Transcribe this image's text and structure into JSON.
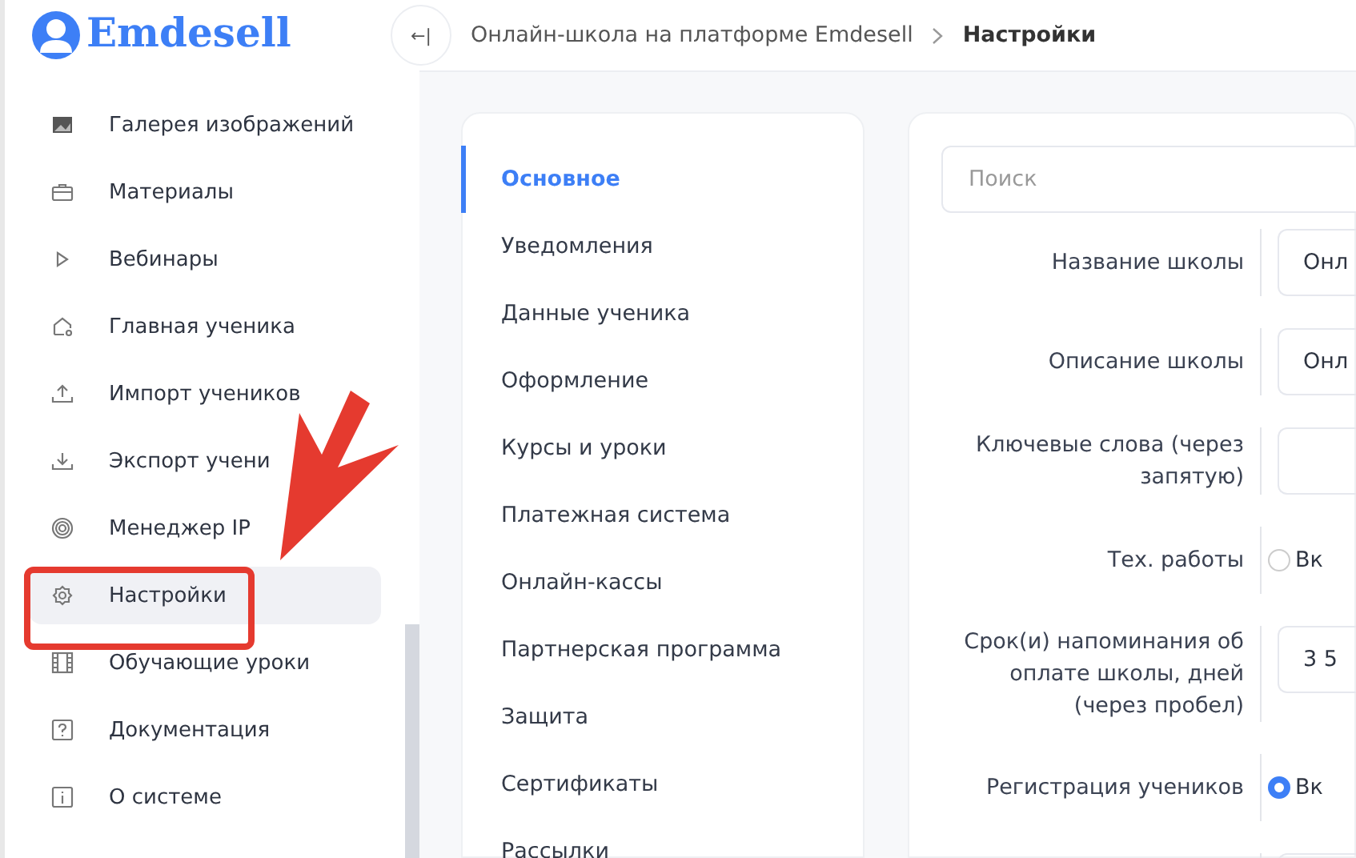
{
  "logo": {
    "text": "Emdesell"
  },
  "sidebar": {
    "items": [
      {
        "label": "Галерея изображений",
        "selected": false
      },
      {
        "label": "Материалы",
        "selected": false
      },
      {
        "label": "Вебинары",
        "selected": false
      },
      {
        "label": "Главная ученика",
        "selected": false
      },
      {
        "label": "Импорт учеников",
        "selected": false
      },
      {
        "label": "Экспорт учени",
        "selected": false
      },
      {
        "label": "Менеджер IP",
        "selected": false
      },
      {
        "label": "Настройки",
        "selected": true
      },
      {
        "label": "Обучающие уроки",
        "selected": false
      },
      {
        "label": "Документация",
        "selected": false
      },
      {
        "label": "О системе",
        "selected": false
      }
    ]
  },
  "header": {
    "collapse_icon": "←|",
    "breadcrumbs": [
      {
        "label": "Онлайн-школа на платформе Emdesell",
        "current": false
      },
      {
        "label": "Настройки",
        "current": true
      }
    ]
  },
  "settings_nav": {
    "items": [
      {
        "label": "Основное",
        "selected": true
      },
      {
        "label": "Уведомления",
        "selected": false
      },
      {
        "label": "Данные ученика",
        "selected": false
      },
      {
        "label": "Оформление",
        "selected": false
      },
      {
        "label": "Курсы и уроки",
        "selected": false
      },
      {
        "label": "Платежная система",
        "selected": false
      },
      {
        "label": "Онлайн-кассы",
        "selected": false
      },
      {
        "label": "Партнерская программа",
        "selected": false
      },
      {
        "label": "Защита",
        "selected": false
      },
      {
        "label": "Сертификаты",
        "selected": false
      },
      {
        "label": "Рассылки",
        "selected": false
      }
    ]
  },
  "search": {
    "placeholder": "Поиск"
  },
  "form": {
    "rows": [
      {
        "kind": "input",
        "label": "Название школы",
        "value": "Онл"
      },
      {
        "kind": "input",
        "label": "Описание школы",
        "value": "Онл"
      },
      {
        "kind": "input",
        "label": "Ключевые слова (через запятую)",
        "value": ""
      },
      {
        "kind": "radio",
        "label": "Тех. работы",
        "option": "Вк",
        "checked": false
      },
      {
        "kind": "input",
        "label": "Срок(и) напоминания об оплате школы, дней (через пробел)",
        "value": "3 5"
      },
      {
        "kind": "radio",
        "label": "Регистрация учеников",
        "option": "Вк",
        "checked": true
      },
      {
        "kind": "input",
        "label": "",
        "value": ""
      }
    ]
  }
}
